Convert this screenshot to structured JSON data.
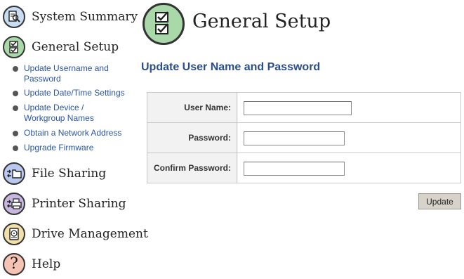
{
  "sidebar": {
    "items": [
      {
        "label": "System Summary",
        "icon": "magnifier-document-icon",
        "color": "#c8dcf2"
      },
      {
        "label": "General Setup",
        "icon": "checklist-icon",
        "color": "#a9d9a8"
      },
      {
        "label": "File Sharing",
        "icon": "folder-arrows-icon",
        "color": "#b9c8ef"
      },
      {
        "label": "Printer Sharing",
        "icon": "printer-arrows-icon",
        "color": "#c7b6e0"
      },
      {
        "label": "Drive Management",
        "icon": "hard-drive-icon",
        "color": "#f2e0a8"
      },
      {
        "label": "Help",
        "icon": "question-icon",
        "color": "#f5c4b5"
      }
    ],
    "subitems": [
      {
        "label": "Update Username and Password"
      },
      {
        "label": "Update Date/Time Settings"
      },
      {
        "label": "Update Device / Workgroup Names"
      },
      {
        "label": "Obtain a Network Address"
      },
      {
        "label": "Upgrade Firmware"
      }
    ]
  },
  "header": {
    "title": "General Setup",
    "icon": "checklist-icon",
    "accent": "#a9d9a8"
  },
  "main": {
    "section_title": "Update User Name and Password",
    "fields": [
      {
        "label": "User Name:",
        "value": "",
        "placeholder": ""
      },
      {
        "label": "Password:",
        "value": "",
        "placeholder": ""
      },
      {
        "label": "Confirm Password:",
        "value": "",
        "placeholder": ""
      }
    ],
    "update_label": "Update"
  },
  "colors": {
    "link": "#2a55a5",
    "section_title": "#2a4d8e",
    "button_bg": "#d7d2ca",
    "table_bg": "#f2f2f2"
  }
}
